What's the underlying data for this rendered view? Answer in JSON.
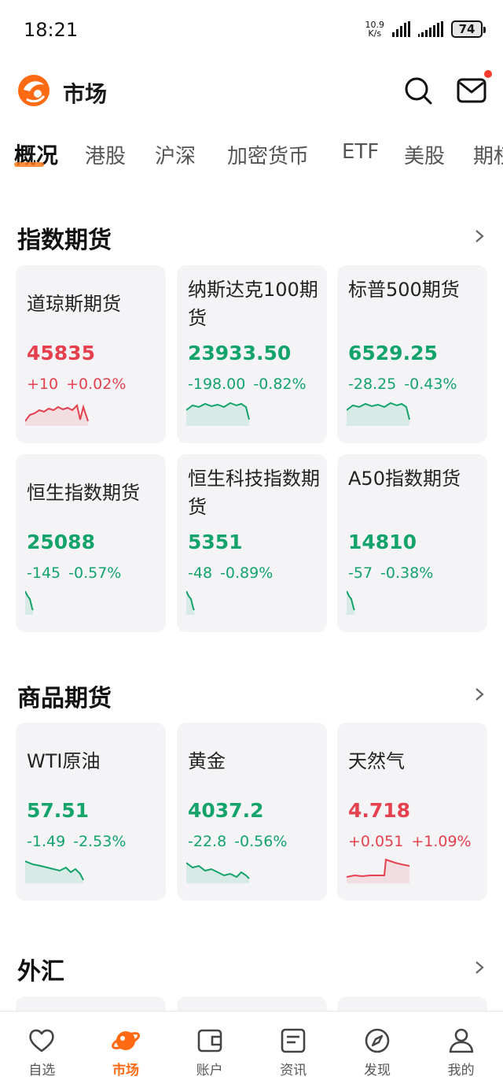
{
  "status_bar": {
    "time": "18:21",
    "net_speed_value": "10.9",
    "net_speed_unit": "K/s",
    "battery": "74"
  },
  "header": {
    "title": "市场"
  },
  "tabs": [
    "概况",
    "港股",
    "沪深",
    "加密货币",
    "ETF",
    "美股",
    "期权"
  ],
  "sections": {
    "index_futures": {
      "title": "指数期货",
      "cards": [
        {
          "name": "道琼斯期货",
          "price": "45835",
          "change": "+10",
          "pct": "+0.02%",
          "trend": "up"
        },
        {
          "name": "纳斯达克100期货",
          "price": "23933.50",
          "change": "-198.00",
          "pct": "-0.82%",
          "trend": "down"
        },
        {
          "name": "标普500期货",
          "price": "6529.25",
          "change": "-28.25",
          "pct": "-0.43%",
          "trend": "down"
        },
        {
          "name": "恒生指数期货",
          "price": "25088",
          "change": "-145",
          "pct": "-0.57%",
          "trend": "down"
        },
        {
          "name": "恒生科技指数期货",
          "price": "5351",
          "change": "-48",
          "pct": "-0.89%",
          "trend": "down"
        },
        {
          "name": "A50指数期货",
          "price": "14810",
          "change": "-57",
          "pct": "-0.38%",
          "trend": "down"
        }
      ]
    },
    "commodity_futures": {
      "title": "商品期货",
      "cards": [
        {
          "name": "WTI原油",
          "price": "57.51",
          "change": "-1.49",
          "pct": "-2.53%",
          "trend": "down"
        },
        {
          "name": "黄金",
          "price": "4037.2",
          "change": "-22.8",
          "pct": "-0.56%",
          "trend": "down"
        },
        {
          "name": "天然气",
          "price": "4.718",
          "change": "+0.051",
          "pct": "+1.09%",
          "trend": "up"
        }
      ]
    },
    "forex": {
      "title": "外汇"
    }
  },
  "bottom_nav": [
    {
      "label": "自选",
      "icon": "heart-icon"
    },
    {
      "label": "市场",
      "icon": "planet-icon",
      "active": true
    },
    {
      "label": "账户",
      "icon": "wallet-icon"
    },
    {
      "label": "资讯",
      "icon": "news-icon"
    },
    {
      "label": "发现",
      "icon": "compass-icon"
    },
    {
      "label": "我的",
      "icon": "user-icon"
    }
  ],
  "colors": {
    "up": "#e5404e",
    "down": "#13a36b",
    "accent": "#ff6a13",
    "card_bg": "#f4f4f6"
  }
}
